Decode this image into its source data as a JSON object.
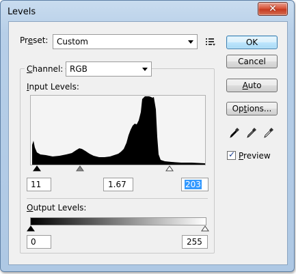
{
  "window": {
    "title": "Levels",
    "close_glyph": "✕"
  },
  "preset": {
    "label_prefix": "Pr",
    "label_accel": "e",
    "label_suffix": "set:",
    "value": "Custom",
    "menu_icon": "preset-options-icon"
  },
  "channel": {
    "label_accel": "C",
    "label_suffix": "hannel:",
    "value": "RGB"
  },
  "input_levels": {
    "label_accel": "I",
    "label_suffix": "nput Levels:",
    "black": "11",
    "gamma": "1.67",
    "white": "203"
  },
  "output_levels": {
    "label_accel": "O",
    "label_suffix": "utput Levels:",
    "black": "0",
    "white": "255"
  },
  "buttons": {
    "ok": "OK",
    "cancel": "Cancel",
    "auto_accel": "A",
    "auto_suffix": "uto",
    "options_prefix": "Op",
    "options_accel": "t",
    "options_suffix": "ions..."
  },
  "preview": {
    "label_accel": "P",
    "label_suffix": "review",
    "checked": true,
    "check_glyph": "✓"
  },
  "eyedroppers": [
    "black-point-eyedropper-icon",
    "gray-point-eyedropper-icon",
    "white-point-eyedropper-icon"
  ],
  "colors": {
    "title_bar": "#b7cfe8",
    "close_button": "#c63b21",
    "default_button": "#bee6fd",
    "selection": "#3399ff"
  }
}
